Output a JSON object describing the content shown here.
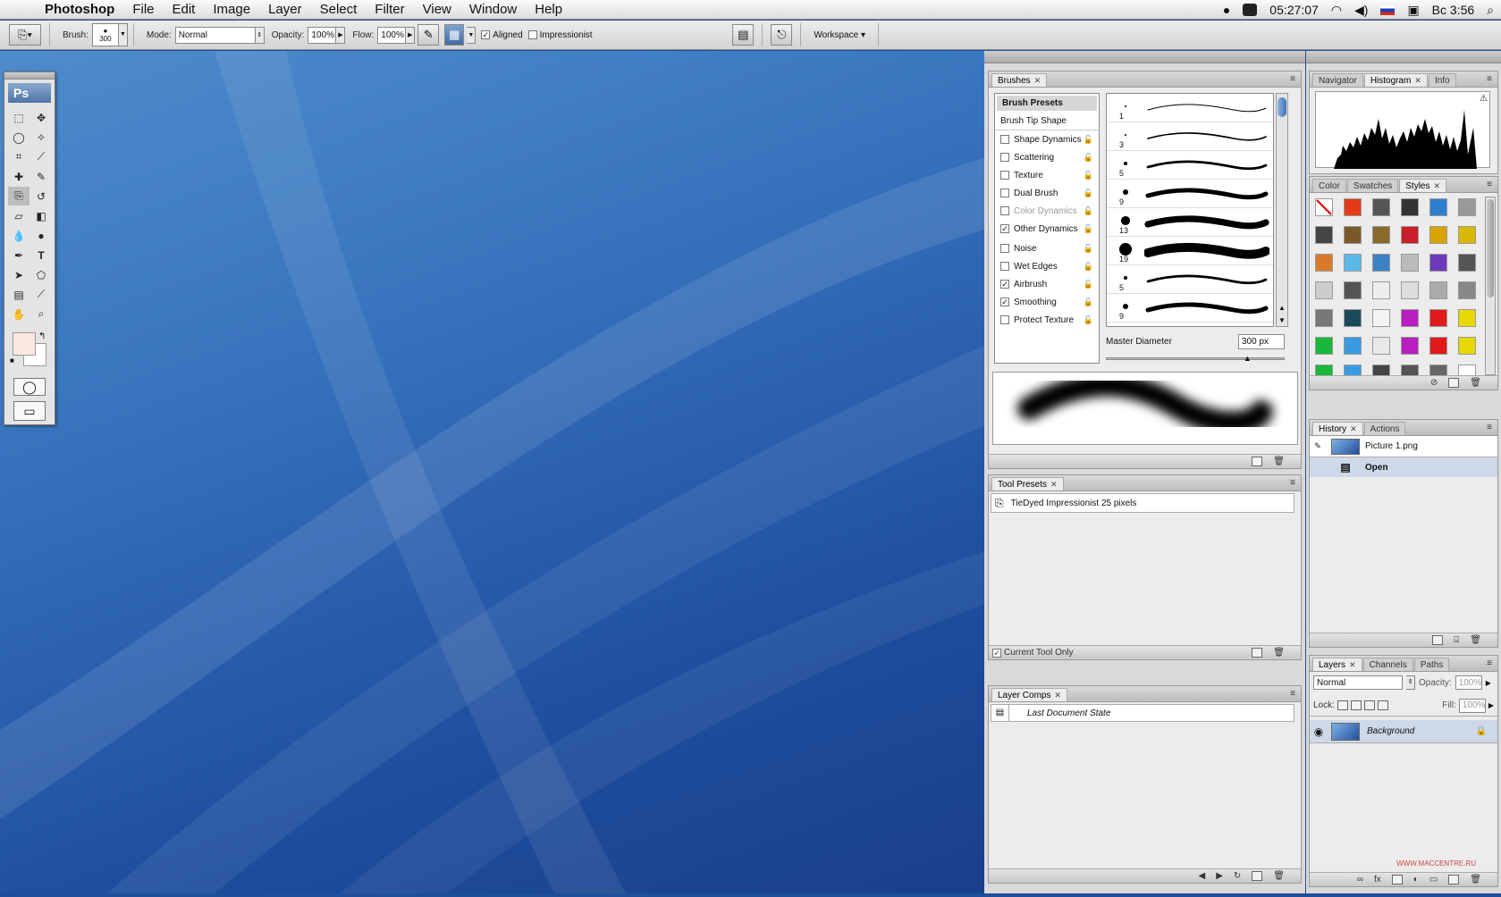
{
  "menubar": {
    "app": "Photoshop",
    "items": [
      "File",
      "Edit",
      "Image",
      "Layer",
      "Select",
      "Filter",
      "View",
      "Window",
      "Help"
    ],
    "time": "05:27:07",
    "clock": "Вс 3:56"
  },
  "options": {
    "brush_label": "Brush:",
    "brush_size": "300",
    "mode_label": "Mode:",
    "mode_value": "Normal",
    "opacity_label": "Opacity:",
    "opacity_value": "100%",
    "flow_label": "Flow:",
    "flow_value": "100%",
    "aligned_label": "Aligned",
    "impressionist_label": "Impressionist",
    "workspace_label": "Workspace"
  },
  "toolbox": {
    "logo": "Ps"
  },
  "brushes": {
    "tab": "Brushes",
    "presets_label": "Brush Presets",
    "tip_shape_label": "Brush Tip Shape",
    "options": [
      {
        "label": "Shape Dynamics",
        "checked": false,
        "dim": false
      },
      {
        "label": "Scattering",
        "checked": false,
        "dim": false
      },
      {
        "label": "Texture",
        "checked": false,
        "dim": false
      },
      {
        "label": "Dual Brush",
        "checked": false,
        "dim": false
      },
      {
        "label": "Color Dynamics",
        "checked": false,
        "dim": true
      },
      {
        "label": "Other Dynamics",
        "checked": true,
        "dim": false
      },
      {
        "label": "Noise",
        "checked": false,
        "dim": false
      },
      {
        "label": "Wet Edges",
        "checked": false,
        "dim": false
      },
      {
        "label": "Airbrush",
        "checked": true,
        "dim": false
      },
      {
        "label": "Smoothing",
        "checked": true,
        "dim": false
      },
      {
        "label": "Protect Texture",
        "checked": false,
        "dim": false
      }
    ],
    "preset_sizes": [
      "1",
      "3",
      "5",
      "9",
      "13",
      "19",
      "5",
      "9"
    ],
    "master_diameter_label": "Master Diameter",
    "master_diameter_value": "300 px",
    "master_diameter_slider": 0.78
  },
  "tool_presets": {
    "tab": "Tool Presets",
    "item": "TieDyed Impressionist 25 pixels",
    "current_only_label": "Current Tool Only"
  },
  "layer_comps": {
    "tab": "Layer Comps",
    "item": "Last Document State"
  },
  "navigator": {
    "tabs": [
      "Navigator",
      "Histogram",
      "Info"
    ],
    "active": "Histogram"
  },
  "styles": {
    "tabs": [
      "Color",
      "Swatches",
      "Styles"
    ],
    "active": "Styles"
  },
  "history": {
    "tabs": [
      "History",
      "Actions"
    ],
    "snapshot": "Picture 1.png",
    "step": "Open"
  },
  "layers": {
    "tabs": [
      "Layers",
      "Channels",
      "Paths"
    ],
    "blend_mode": "Normal",
    "opacity_label": "Opacity:",
    "opacity_value": "100%",
    "lock_label": "Lock:",
    "fill_label": "Fill:",
    "fill_value": "100%",
    "layer_name": "Background"
  },
  "watermark": "WWW.MACCENTRE.RU"
}
